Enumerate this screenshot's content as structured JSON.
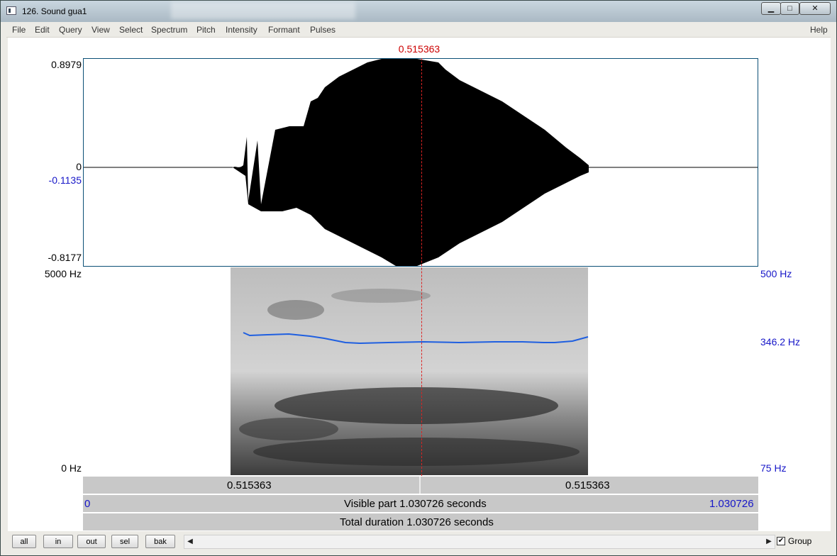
{
  "window": {
    "title": "126. Sound gua1"
  },
  "menu": [
    "File",
    "Edit",
    "Query",
    "View",
    "Select",
    "Spectrum",
    "Pitch",
    "Intensity",
    "Formant",
    "Pulses"
  ],
  "help": "Help",
  "cursor_time": "0.515363",
  "waveform": {
    "max": "0.8979",
    "zero": "0",
    "cursor_value": "-0.1135",
    "min": "-0.8177"
  },
  "spectrogram": {
    "top": "5000 Hz",
    "bottom": "0 Hz"
  },
  "pitch": {
    "top": "500 Hz",
    "value": "346.2 Hz",
    "bottom": "75 Hz",
    "color": "#1f5fe0"
  },
  "timebar": {
    "left": "0.515363",
    "right": "0.515363"
  },
  "visible": {
    "start": "0",
    "label": "Visible part 1.030726 seconds",
    "end": "1.030726"
  },
  "total": {
    "label": "Total duration 1.030726 seconds"
  },
  "buttons": {
    "all": "all",
    "in": "in",
    "out": "out",
    "sel": "sel",
    "bak": "bak"
  },
  "group": {
    "label": "Group",
    "checked": "✔"
  },
  "window_controls": {
    "minimize": "▁",
    "maximize": "□",
    "close": "✕"
  },
  "scroll": {
    "left": "◀",
    "right": "▶"
  }
}
